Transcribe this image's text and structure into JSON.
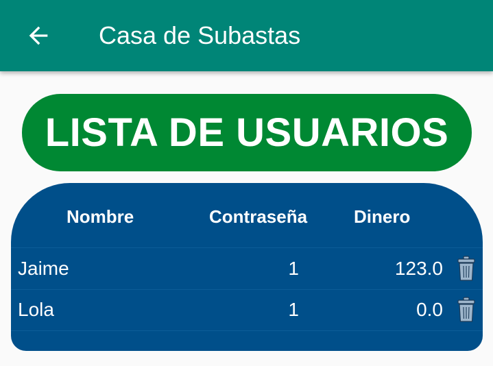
{
  "appbar": {
    "title": "Casa de Subastas",
    "back_icon": "arrow-left-icon"
  },
  "colors": {
    "appbar": "#008577",
    "title_pill": "#008833",
    "table_panel": "#004f8a",
    "trash_icon": "#9eb6cc"
  },
  "main": {
    "heading": "LISTA DE USUARIOS"
  },
  "table": {
    "headers": {
      "name": "Nombre",
      "password": "Contraseña",
      "money": "Dinero"
    },
    "rows": [
      {
        "name": "Jaime",
        "password": "1",
        "money": "123.0",
        "action_icon": "trash-icon"
      },
      {
        "name": "Lola",
        "password": "1",
        "money": "0.0",
        "action_icon": "trash-icon"
      }
    ]
  }
}
